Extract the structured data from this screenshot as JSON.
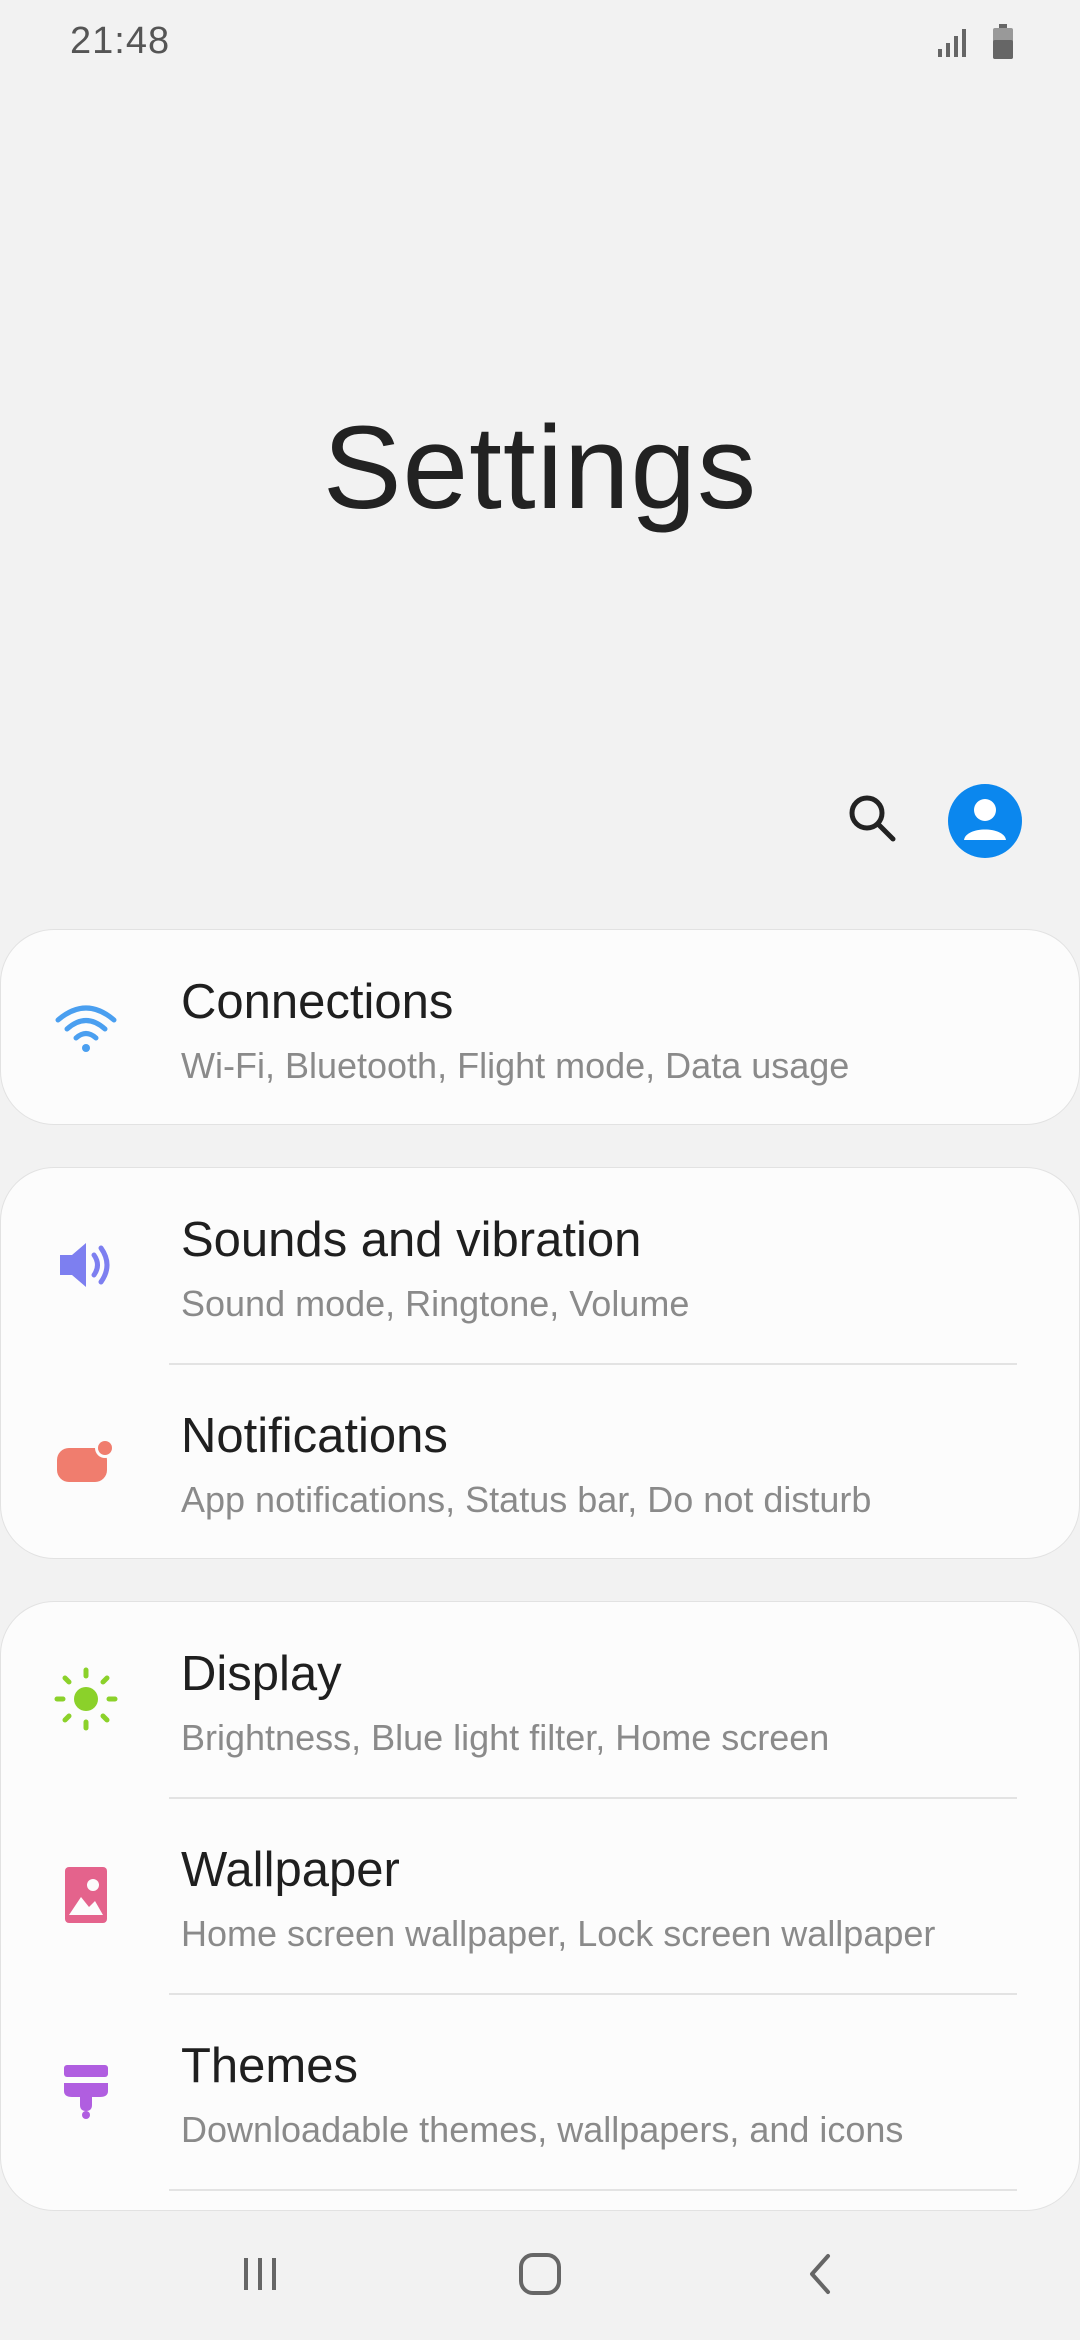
{
  "status": {
    "time": "21:48",
    "signal_icon": "signal-icon",
    "battery_icon": "battery-icon"
  },
  "header": {
    "title": "Settings"
  },
  "actions": {
    "search_icon": "search-icon",
    "profile_icon": "profile-icon",
    "profile_color": "#0b87ee"
  },
  "cards": [
    {
      "items": [
        {
          "icon": "wifi-icon",
          "color": "#4a9ff0",
          "title": "Connections",
          "subtitle": "Wi-Fi, Bluetooth, Flight mode, Data usage"
        }
      ]
    },
    {
      "items": [
        {
          "icon": "volume-icon",
          "color": "#7d7ff0",
          "title": "Sounds and vibration",
          "subtitle": "Sound mode, Ringtone, Volume"
        },
        {
          "icon": "notification-icon",
          "color": "#f07d6e",
          "title": "Notifications",
          "subtitle": "App notifications, Status bar, Do not disturb"
        }
      ]
    },
    {
      "items": [
        {
          "icon": "display-icon",
          "color": "#8bd12a",
          "title": "Display",
          "subtitle": "Brightness, Blue light filter, Home screen"
        },
        {
          "icon": "wallpaper-icon",
          "color": "#e4638c",
          "title": "Wallpaper",
          "subtitle": "Home screen wallpaper, Lock screen wallpaper"
        },
        {
          "icon": "themes-icon",
          "color": "#b05ee0",
          "title": "Themes",
          "subtitle": "Downloadable themes, wallpapers, and icons"
        }
      ]
    }
  ],
  "nav": {
    "recents_icon": "recents-icon",
    "home_icon": "home-icon",
    "back_icon": "back-icon"
  }
}
